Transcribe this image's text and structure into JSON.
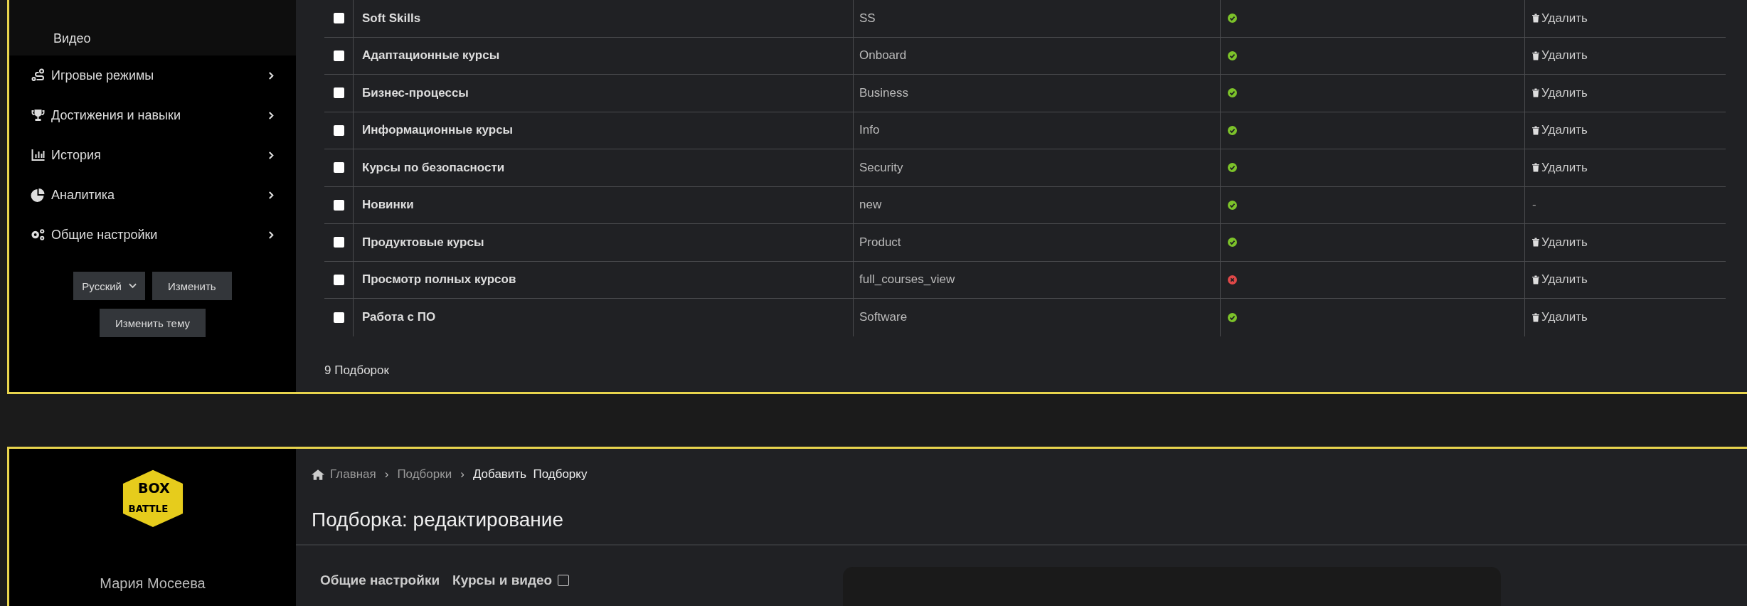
{
  "sidebar": {
    "submenu": [
      {
        "label": "Видео"
      }
    ],
    "items": [
      {
        "label": "Игровые режимы"
      },
      {
        "label": "Достижения и навыки"
      },
      {
        "label": "История"
      },
      {
        "label": "Аналитика"
      },
      {
        "label": "Общие настройки"
      }
    ],
    "language": {
      "value": "Русский"
    },
    "apply_button": "Изменить",
    "theme_button": "Изменить тему"
  },
  "table": {
    "rows": [
      {
        "checked": false,
        "name": "Soft Skills",
        "code": "SS",
        "active": true,
        "action": "Удалить"
      },
      {
        "checked": false,
        "name": "Адаптационные курсы",
        "code": "Onboard",
        "active": true,
        "action": "Удалить"
      },
      {
        "checked": false,
        "name": "Бизнес-процессы",
        "code": "Business",
        "active": true,
        "action": "Удалить"
      },
      {
        "checked": false,
        "name": "Информационные курсы",
        "code": "Info",
        "active": true,
        "action": "Удалить"
      },
      {
        "checked": false,
        "name": "Курсы по безопасности",
        "code": "Security",
        "active": true,
        "action": "Удалить"
      },
      {
        "checked": false,
        "name": "Новинки",
        "code": "new",
        "active": true,
        "action": "-"
      },
      {
        "checked": false,
        "name": "Продуктовые курсы",
        "code": "Product",
        "active": true,
        "action": "Удалить"
      },
      {
        "checked": false,
        "name": "Просмотр полных курсов",
        "code": "full_courses_view",
        "active": false,
        "action": "Удалить"
      },
      {
        "checked": false,
        "name": "Работа с ПО",
        "code": "Software",
        "active": true,
        "action": "Удалить"
      }
    ],
    "footer": "9 Подборок"
  },
  "edit_page": {
    "logo": [
      "BOX",
      "BATTLE"
    ],
    "user_name": "Мария Мосеева",
    "breadcrumb": [
      {
        "label": "Главная",
        "current": false
      },
      {
        "separator": "›",
        "label": "Подборки",
        "current": false
      },
      {
        "separator": "›",
        "label": "Добавить  Подборку",
        "current": true
      }
    ],
    "title": "Подборка: редактирование",
    "sections": [
      {
        "label": "Общие настройки"
      },
      {
        "label": "Курсы и видео",
        "checkbox": {
          "checked": false
        }
      }
    ]
  }
}
